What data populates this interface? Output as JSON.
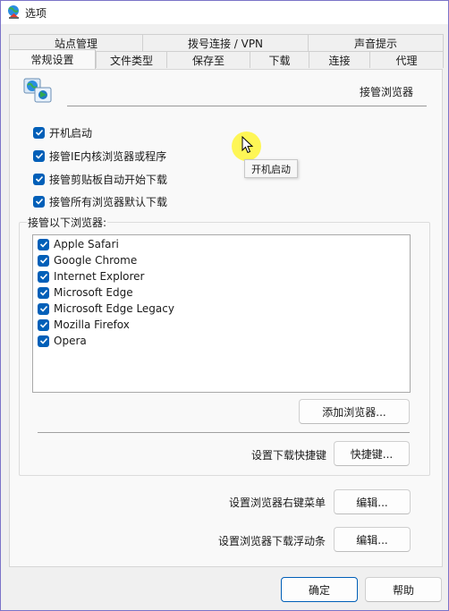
{
  "window": {
    "title": "选项"
  },
  "tabs": {
    "row_top": [
      "站点管理",
      "拨号连接 / VPN",
      "声音提示"
    ],
    "row_bottom": [
      "常规设置",
      "文件类型",
      "保存至",
      "下载",
      "连接",
      "代理"
    ],
    "active": "常规设置"
  },
  "panel": {
    "header_title": "接管浏览器",
    "options": [
      {
        "label": "开机启动",
        "checked": true
      },
      {
        "label": "接管IE内核浏览器或程序",
        "checked": true
      },
      {
        "label": "接管剪贴板自动开始下载",
        "checked": true
      },
      {
        "label": "接管所有浏览器默认下载",
        "checked": true
      }
    ],
    "tooltip": "开机启动",
    "browsers_group_label": "接管以下浏览器:",
    "browsers": [
      {
        "label": "Apple Safari",
        "checked": true
      },
      {
        "label": "Google Chrome",
        "checked": true
      },
      {
        "label": "Internet Explorer",
        "checked": true
      },
      {
        "label": "Microsoft Edge",
        "checked": true
      },
      {
        "label": "Microsoft Edge Legacy",
        "checked": true
      },
      {
        "label": "Mozilla Firefox",
        "checked": true
      },
      {
        "label": "Opera",
        "checked": true
      }
    ],
    "add_browser_button": "添加浏览器...",
    "hotkey_label": "设置下载快捷键",
    "hotkey_button": "快捷键...",
    "context_menu_label": "设置浏览器右键菜单",
    "context_menu_button": "编辑...",
    "float_bar_label": "设置浏览器下载浮动条",
    "float_bar_button": "编辑..."
  },
  "footer": {
    "ok_button": "确定",
    "help_button": "帮助"
  },
  "colors": {
    "accent": "#005fb8",
    "cursor_highlight": "#fff528",
    "window_border": "#7b74c8"
  },
  "icons": {
    "app": "idm-globe-icon",
    "header": "browser-integration-icon",
    "checkbox": "checkmark-icon",
    "cursor": "mouse-pointer-icon"
  }
}
